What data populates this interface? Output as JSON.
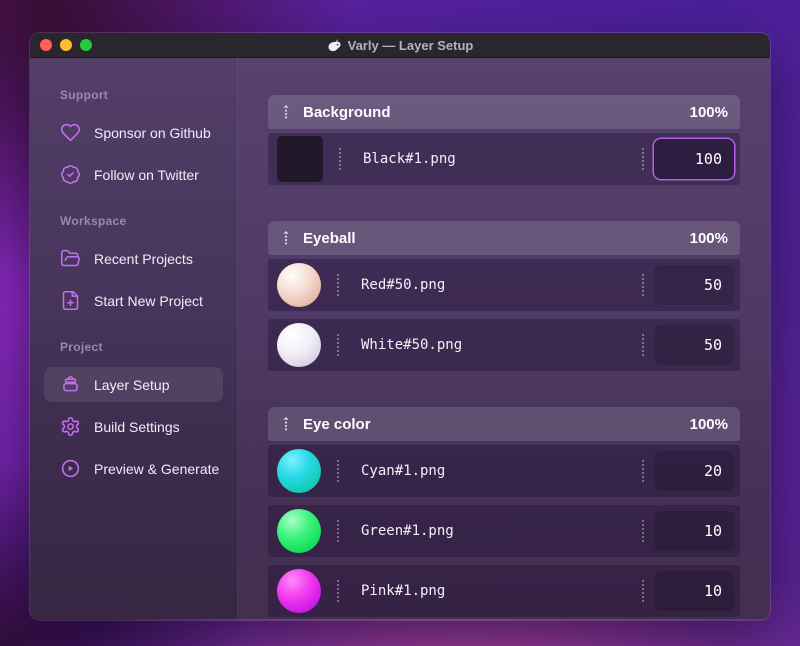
{
  "colors": {
    "accent": "#b55fe8",
    "icon": "#c26ff0",
    "drag_handle": "#d9d1e6",
    "traffic_close": "#ff5f57",
    "traffic_minimize": "#febc2e",
    "traffic_zoom": "#28c840",
    "thumb_black": "#211929",
    "thumb_red": "#f6ddd3",
    "thumb_white": "#f2eef6",
    "thumb_cyan": "#2bd9e8",
    "thumb_green": "#17e060",
    "thumb_pink": "#e02df0"
  },
  "window": {
    "title": "Varly — Layer Setup",
    "app_icon": "unicorn-icon"
  },
  "sidebar": {
    "sections": [
      {
        "label": "Support",
        "items": [
          {
            "icon": "heart-icon",
            "label": "Sponsor on Github",
            "active": false
          },
          {
            "icon": "verified-check-icon",
            "label": "Follow on Twitter",
            "active": false
          }
        ]
      },
      {
        "label": "Workspace",
        "items": [
          {
            "icon": "folder-open-icon",
            "label": "Recent Projects",
            "active": false
          },
          {
            "icon": "file-plus-icon",
            "label": "Start New Project",
            "active": false
          }
        ]
      },
      {
        "label": "Project",
        "items": [
          {
            "icon": "layers-stack-icon",
            "label": "Layer Setup",
            "active": true
          },
          {
            "icon": "gear-icon",
            "label": "Build Settings",
            "active": false
          },
          {
            "icon": "play-circle-icon",
            "label": "Preview & Generate",
            "active": false
          }
        ]
      }
    ]
  },
  "main": {
    "groups": [
      {
        "name": "Background",
        "percent": "100%",
        "layers": [
          {
            "thumb": "black-square",
            "file": "Black#1.png",
            "weight": "100",
            "focused": true
          }
        ]
      },
      {
        "name": "Eyeball",
        "percent": "100%",
        "layers": [
          {
            "thumb": "red-sphere",
            "file": "Red#50.png",
            "weight": "50",
            "focused": false
          },
          {
            "thumb": "white-sphere",
            "file": "White#50.png",
            "weight": "50",
            "focused": false
          }
        ]
      },
      {
        "name": "Eye color",
        "percent": "100%",
        "layers": [
          {
            "thumb": "cyan-sphere",
            "file": "Cyan#1.png",
            "weight": "20",
            "focused": false
          },
          {
            "thumb": "green-sphere",
            "file": "Green#1.png",
            "weight": "10",
            "focused": false
          },
          {
            "thumb": "pink-sphere",
            "file": "Pink#1.png",
            "weight": "10",
            "focused": false
          }
        ]
      }
    ]
  }
}
